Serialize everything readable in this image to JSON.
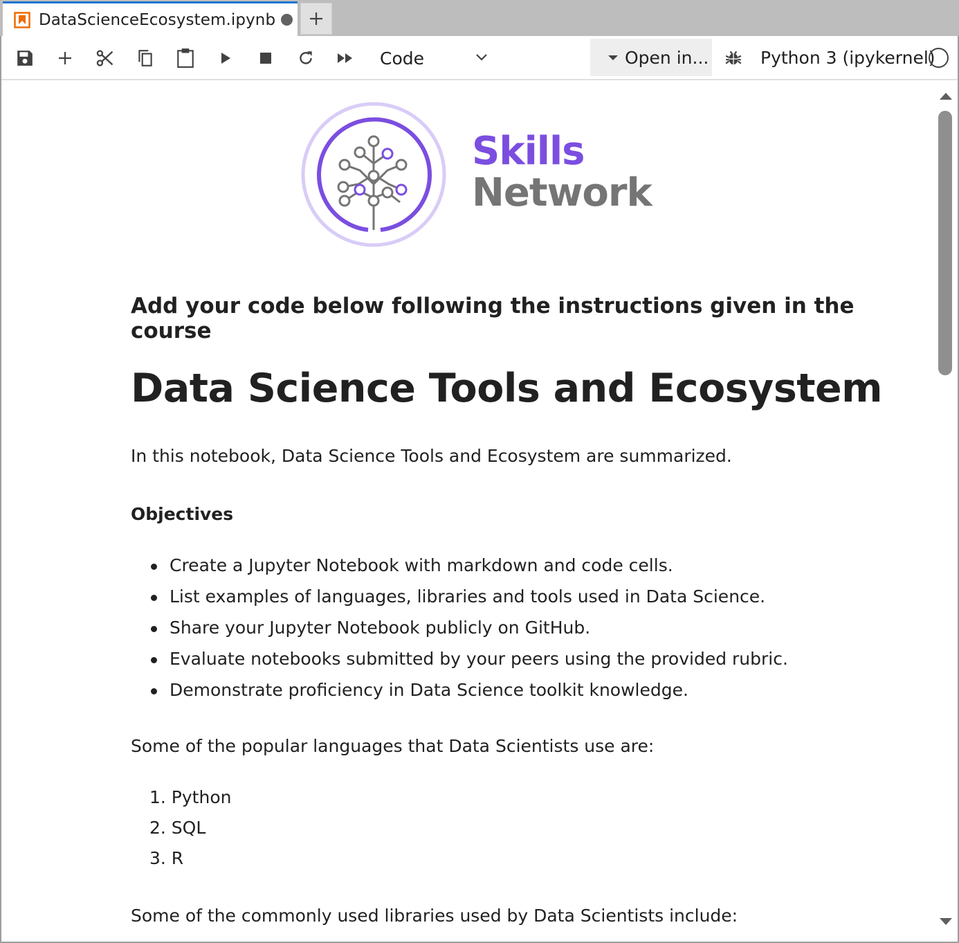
{
  "tab": {
    "title": "DataScienceEcosystem.ipynb",
    "new_tab_label": "+"
  },
  "toolbar": {
    "buttons": [
      "save-icon",
      "add-cell-icon",
      "cut-icon",
      "copy-icon",
      "paste-icon",
      "run-icon",
      "stop-icon",
      "restart-icon",
      "run-all-icon"
    ],
    "cell_type": "Code",
    "open_in": "Open in...",
    "kernel_name": "Python 3 (ipykernel)"
  },
  "logo": {
    "line1": "Skills",
    "line2": "Network",
    "brand_color": "#7b4ee0",
    "gray_color": "#757575"
  },
  "notebook": {
    "instruction": "Add your code below following the instructions given in the course",
    "title": "Data Science Tools and Ecosystem",
    "intro": "In this notebook, Data Science Tools and Ecosystem are summarized.",
    "objectives_heading": "Objectives",
    "objectives": [
      "Create a Jupyter Notebook with markdown and code cells.",
      "List examples of languages, libraries and tools used in Data Science.",
      "Share your Jupyter Notebook publicly on GitHub.",
      "Evaluate notebooks submitted by your peers using the provided rubric.",
      "Demonstrate proficiency in Data Science toolkit knowledge."
    ],
    "languages_intro": "Some of the popular languages that Data Scientists use are:",
    "languages": [
      "1. Python",
      "2. SQL",
      "3. R"
    ],
    "libraries_intro": "Some of the commonly used libraries used by Data Scientists include:"
  }
}
